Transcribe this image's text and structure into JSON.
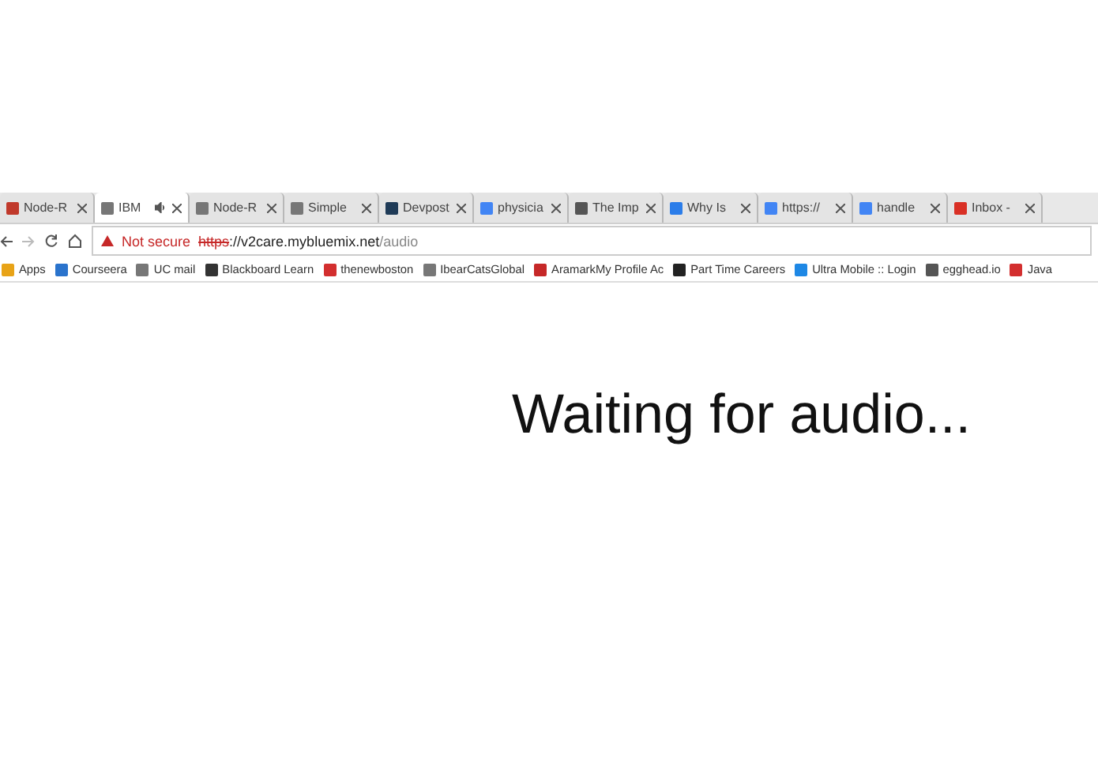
{
  "tabs": [
    {
      "title": "Node-R",
      "selected": false,
      "color": "#c0392b",
      "audible": false
    },
    {
      "title": "IBM",
      "selected": true,
      "color": "#777777",
      "audible": true
    },
    {
      "title": "Node-R",
      "selected": false,
      "color": "#777777",
      "audible": false
    },
    {
      "title": "Simple",
      "selected": false,
      "color": "#777777",
      "audible": false
    },
    {
      "title": "Devpost",
      "selected": false,
      "color": "#1f3b57",
      "audible": false
    },
    {
      "title": "physicia",
      "selected": false,
      "color": "#4285f4",
      "audible": false
    },
    {
      "title": "The Imp",
      "selected": false,
      "color": "#555555",
      "audible": false
    },
    {
      "title": "Why Is",
      "selected": false,
      "color": "#2b7de9",
      "audible": false
    },
    {
      "title": "https://",
      "selected": false,
      "color": "#4285f4",
      "audible": false
    },
    {
      "title": "handle",
      "selected": false,
      "color": "#4285f4",
      "audible": false
    },
    {
      "title": "Inbox -",
      "selected": false,
      "color": "#d93025",
      "audible": false
    }
  ],
  "address": {
    "security": "Not secure",
    "scheme": "https",
    "host": "://v2care.mybluemix.net",
    "path": "/audio"
  },
  "bookmarks": [
    {
      "label": "Apps",
      "color": "#e8a317"
    },
    {
      "label": "Courseera",
      "color": "#2a73cc"
    },
    {
      "label": "UC mail",
      "color": "#777777"
    },
    {
      "label": "Blackboard Learn",
      "color": "#333333"
    },
    {
      "label": "thenewboston",
      "color": "#d32f2f"
    },
    {
      "label": "IbearCatsGlobal",
      "color": "#777777"
    },
    {
      "label": "AramarkMy Profile Ac",
      "color": "#c62828"
    },
    {
      "label": "Part Time Careers",
      "color": "#222222"
    },
    {
      "label": "Ultra Mobile :: Login",
      "color": "#1e88e5"
    },
    {
      "label": "egghead.io",
      "color": "#555555"
    },
    {
      "label": "Java",
      "color": "#d32f2f"
    }
  ],
  "message": "Waiting for audio..."
}
